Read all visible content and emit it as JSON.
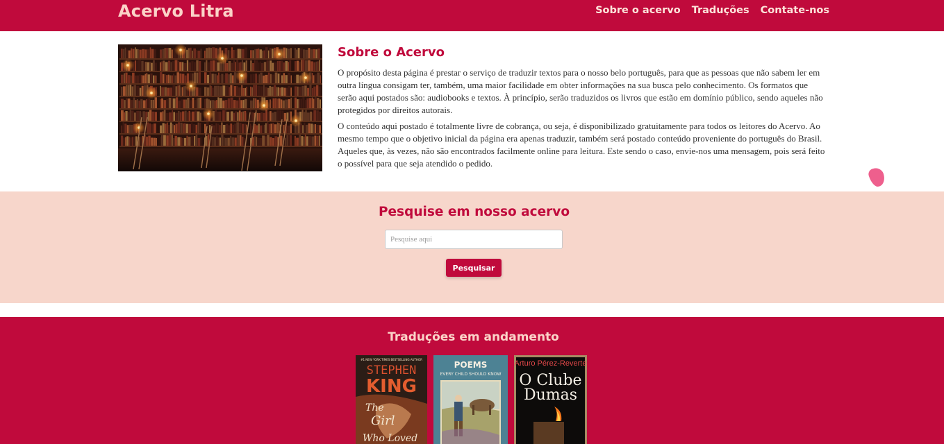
{
  "header": {
    "brand": "Acervo Litra",
    "nav": [
      "Sobre o acervo",
      "Traduções",
      "Contate-nos"
    ]
  },
  "about": {
    "title": "Sobre o Acervo",
    "paragraphs": [
      "O propósito desta página é prestar o serviço de traduzir textos para o nosso belo português, para que as pessoas que não sabem ler em outra língua consigam ter, também, uma maior facilidade em obter informações na sua busca pelo conhecimento. Os formatos que serão aqui postados são: audiobooks e textos. À princípio, serão traduzidos os livros que estão em domínio público, sendo aqueles não protegidos por direitos autorais.",
      "O conteúdo aqui postado é totalmente livre de cobrança, ou seja, é disponibilizado gratuitamente para todos os leitores do Acervo. Ao mesmo tempo que o objetivo inicial da página era apenas traduzir, também será postado conteúdo proveniente do português do Brasil. Aqueles que, às vezes, não são encontrados facilmente online para leitura. Este sendo o caso, envie-nos uma mensagem, pois será feito o possível para que seja atendido o pedido."
    ]
  },
  "search": {
    "title": "Pesquise em nosso acervo",
    "placeholder": "Pesquise aqui",
    "button": "Pesquisar"
  },
  "translations": {
    "title": "Traduções em andamento",
    "books": [
      {
        "banner": "#1 NEW YORK TIMES BESTSELLING AUTHOR",
        "author": "STEPHEN",
        "author2": "KING",
        "title_lines": [
          "The",
          "Girl",
          "Who Loved"
        ]
      },
      {
        "title": "POEMS",
        "subtitle": "EVERY CHILD SHOULD KNOW"
      },
      {
        "author": "Arturo Pérez-Reverte",
        "title_lines": [
          "O Clube",
          "Dumas"
        ]
      }
    ]
  },
  "colors": {
    "primary": "#c00a3c",
    "accent_light": "#fbd3c8",
    "search_bg": "#f7d6cb"
  }
}
